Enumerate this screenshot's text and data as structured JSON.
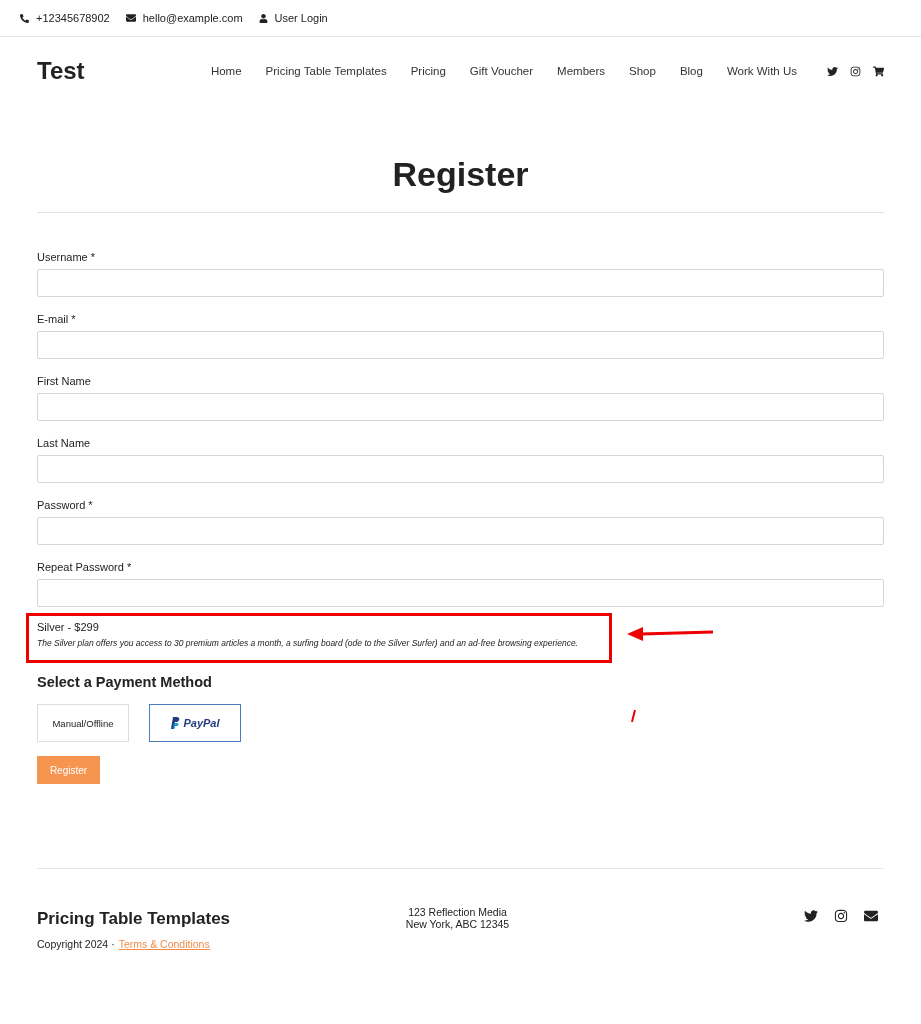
{
  "top_bar": {
    "phone": "+12345678902",
    "email": "hello@example.com",
    "login": "User Login"
  },
  "header": {
    "logo": "Test",
    "nav": [
      "Home",
      "Pricing Table Templates",
      "Pricing",
      "Gift Voucher",
      "Members",
      "Shop",
      "Blog",
      "Work With Us"
    ]
  },
  "page_title": "Register",
  "fields": [
    {
      "label": "Username *"
    },
    {
      "label": "E-mail *"
    },
    {
      "label": "First Name"
    },
    {
      "label": "Last Name"
    },
    {
      "label": "Password *"
    },
    {
      "label": "Repeat Password *"
    }
  ],
  "plan": {
    "name": "Silver - $299",
    "description": "The Silver plan offers you access to 30 premium articles a month, a surfing board (ode to the Silver Surfer) and an ad-free browsing experience."
  },
  "payment": {
    "heading": "Select a Payment Method",
    "methods": [
      {
        "kind": "text",
        "label": "Manual/Offline",
        "selected": false
      },
      {
        "kind": "paypal",
        "label": "PayPal",
        "selected": true
      }
    ]
  },
  "submit": "Register",
  "footer": {
    "title": "Pricing Table Templates",
    "copyright": "Copyright 2024 ·",
    "link": "Terms & Conditions",
    "address": [
      "123 Reflection Media",
      "New York, ABC 12345"
    ]
  }
}
